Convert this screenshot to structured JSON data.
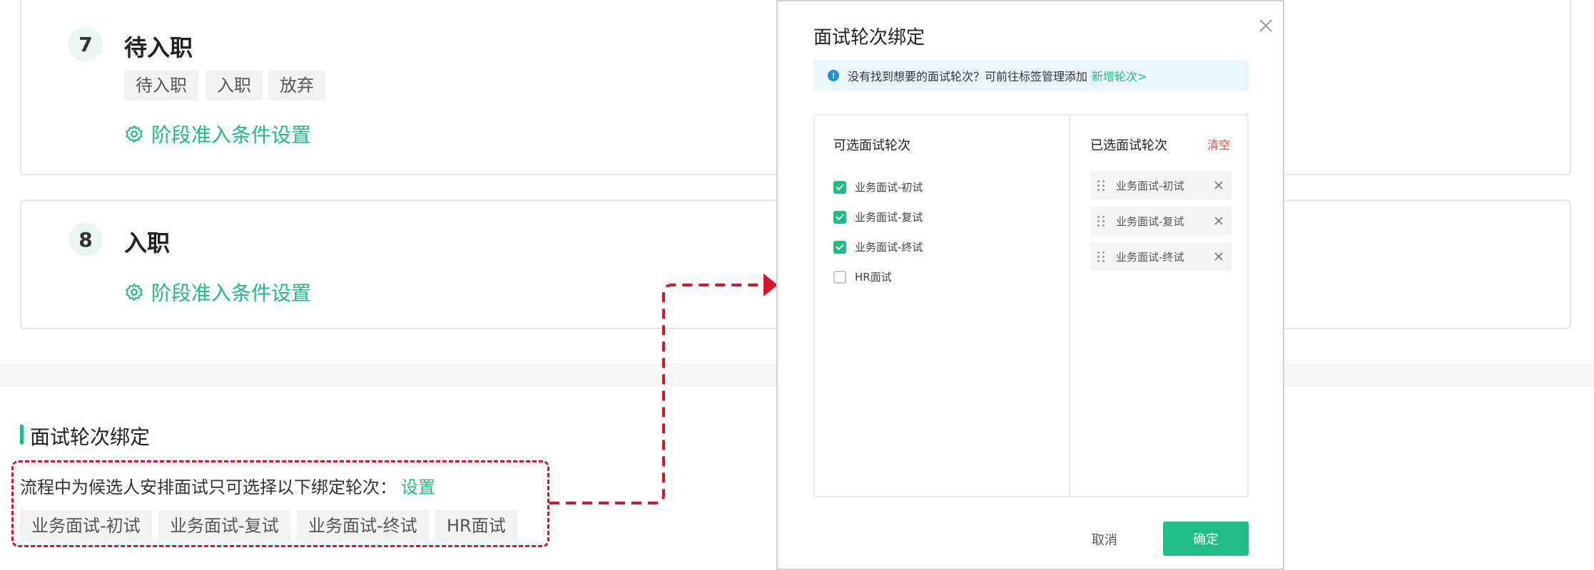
{
  "stages": [
    {
      "number": "7",
      "title": "待入职",
      "tags": [
        "待入职",
        "入职",
        "放弃"
      ],
      "condition_link": "阶段准入条件设置"
    },
    {
      "number": "8",
      "title": "入职",
      "tags": [],
      "condition_link": "阶段准入条件设置"
    }
  ],
  "binding": {
    "section_title": "面试轮次绑定",
    "description": "流程中为候选人安排面试只可选择以下绑定轮次：",
    "set_link": "设置",
    "tags": [
      "业务面试-初试",
      "业务面试-复试",
      "业务面试-终试",
      "HR面试"
    ]
  },
  "modal": {
    "title": "面试轮次绑定",
    "notice_text": "没有找到想要的面试轮次？可前往标签管理添加",
    "notice_link": "新增轮次>",
    "available_title": "可选面试轮次",
    "selected_title": "已选面试轮次",
    "clear_label": "清空",
    "options": [
      {
        "label": "业务面试-初试",
        "checked": true
      },
      {
        "label": "业务面试-复试",
        "checked": true
      },
      {
        "label": "业务面试-终试",
        "checked": true
      },
      {
        "label": "HR面试",
        "checked": false
      }
    ],
    "selected": [
      "业务面试-初试",
      "业务面试-复试",
      "业务面试-终试"
    ],
    "cancel_label": "取消",
    "ok_label": "确定"
  },
  "colors": {
    "accent": "#1ebd84",
    "danger": "#d6172b",
    "clear": "#e8453c",
    "info": "#1f8fe0"
  }
}
